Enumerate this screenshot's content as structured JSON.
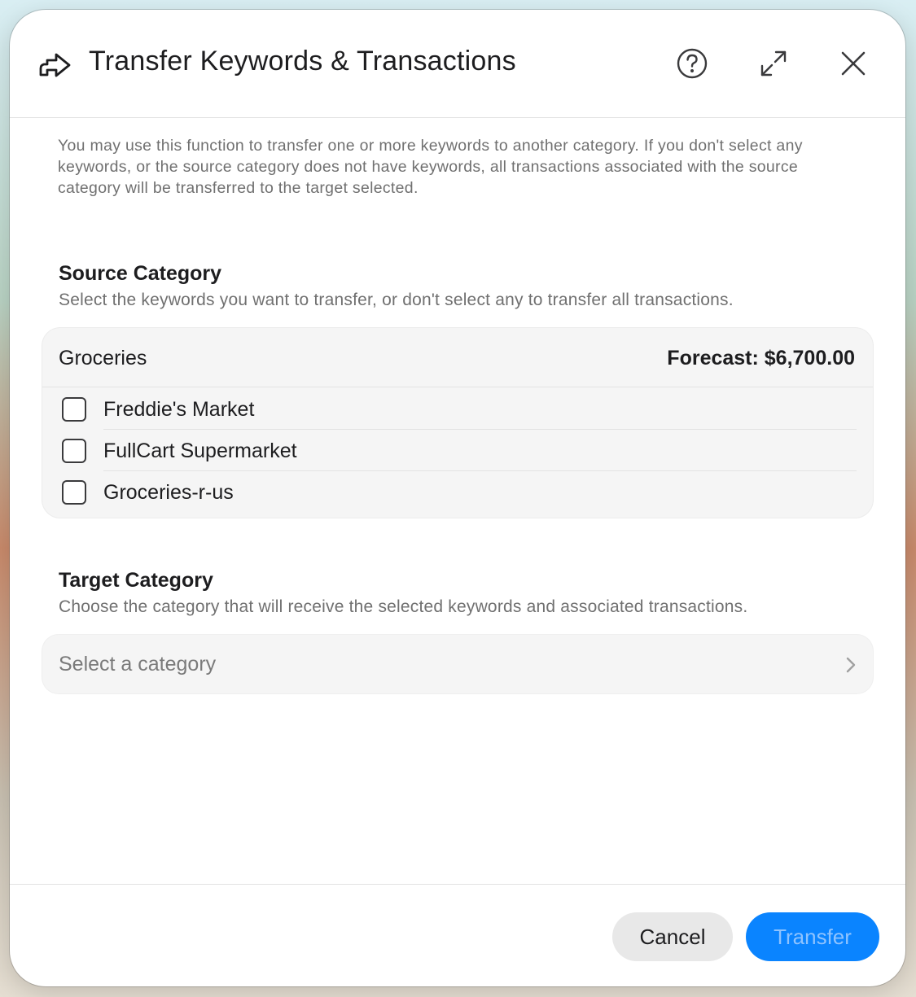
{
  "dialog": {
    "title": "Transfer Keywords & Transactions",
    "description": "You may use this function to transfer one or more keywords to another category. If you don't select any keywords, or the source category does not have keywords, all transactions associated with the source category will be transferred to the target selected."
  },
  "source": {
    "title": "Source Category",
    "subtitle": "Select the keywords you want to transfer, or don't select any to transfer all transactions.",
    "category_name": "Groceries",
    "forecast": "Forecast: $6,700.00",
    "keywords": [
      {
        "label": "Freddie's Market",
        "checked": false
      },
      {
        "label": "FullCart Supermarket",
        "checked": false
      },
      {
        "label": "Groceries-r-us",
        "checked": false
      }
    ]
  },
  "target": {
    "title": "Target Category",
    "subtitle": "Choose the category that will receive the selected keywords and associated transactions.",
    "placeholder": "Select a category"
  },
  "footer": {
    "cancel_label": "Cancel",
    "transfer_label": "Transfer"
  },
  "colors": {
    "accent": "#0a84ff",
    "transfer_text_disabled": "#8ec3ff"
  },
  "icons": {
    "header": "transfer-arrow-icon",
    "help": "help-icon",
    "expand": "expand-icon",
    "close": "close-icon",
    "select": "chevron-right-icon"
  }
}
